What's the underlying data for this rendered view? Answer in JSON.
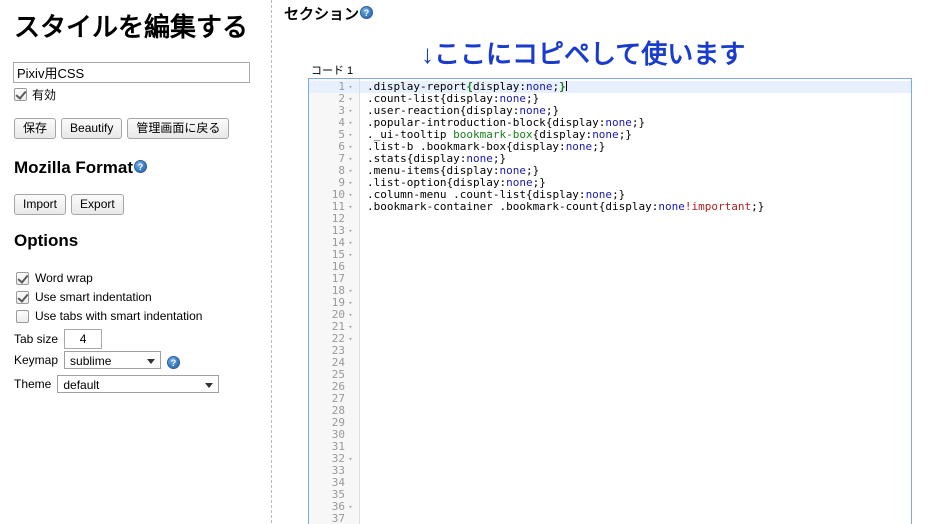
{
  "left": {
    "title": "スタイルを編集する",
    "style_name_input": {
      "value": "Pixiv用CSS",
      "placeholder": ""
    },
    "enabled_checkbox": {
      "label": "有効",
      "checked": true
    },
    "main_buttons": [
      "保存",
      "Beautify",
      "管理画面に戻る"
    ],
    "mozilla_format": {
      "heading": "Mozilla Format",
      "help_icon": "help-icon",
      "buttons": [
        "Import",
        "Export"
      ]
    },
    "options": {
      "heading": "Options",
      "checkboxes": [
        {
          "label": "Word wrap",
          "checked": true
        },
        {
          "label": "Use smart indentation",
          "checked": true
        },
        {
          "label": "Use tabs with smart indentation",
          "checked": false
        }
      ],
      "tab_size": {
        "label": "Tab size",
        "value": "4"
      },
      "keymap": {
        "label": "Keymap",
        "value": "sublime",
        "help_icon": "help-icon"
      },
      "theme": {
        "label": "Theme",
        "value": "default"
      }
    }
  },
  "right": {
    "section_heading": "セクション",
    "section_help_icon": "help-icon",
    "annotation": "↓ここにコピペして使います",
    "annotation_color": "#1a3ccc",
    "code_label": "コード 1",
    "editor": {
      "border_color": "#7fa9e3",
      "active_line_color": "#e8f0fd",
      "total_visible_lines": 37,
      "active_line": 1,
      "fold_marker": "▾",
      "fold_lines": [
        1,
        2,
        3,
        4,
        5,
        6,
        7,
        8,
        9,
        10,
        11,
        13,
        14,
        15,
        18,
        19,
        20,
        21,
        22,
        32,
        36
      ],
      "lines": [
        {
          "n": 1,
          "tokens": [
            {
              "t": ".display-report",
              "c": "sel"
            },
            {
              "t": "{",
              "c": "brace"
            },
            {
              "t": "display",
              "c": "prop"
            },
            {
              "t": ":",
              "c": "prop"
            },
            {
              "t": "none",
              "c": "val"
            },
            {
              "t": ";",
              "c": "prop"
            },
            {
              "t": "}",
              "c": "brace"
            }
          ],
          "caret": true
        },
        {
          "n": 2,
          "tokens": [
            {
              "t": ".count-list",
              "c": "sel"
            },
            {
              "t": "{display:",
              "c": "prop"
            },
            {
              "t": "none",
              "c": "val"
            },
            {
              "t": ";}",
              "c": "prop"
            }
          ]
        },
        {
          "n": 3,
          "tokens": [
            {
              "t": ".user-reaction",
              "c": "sel"
            },
            {
              "t": "{display:",
              "c": "prop"
            },
            {
              "t": "none",
              "c": "val"
            },
            {
              "t": ";}",
              "c": "prop"
            }
          ]
        },
        {
          "n": 4,
          "tokens": [
            {
              "t": ".popular-introduction-block",
              "c": "sel"
            },
            {
              "t": "{display:",
              "c": "prop"
            },
            {
              "t": "none",
              "c": "val"
            },
            {
              "t": ";}",
              "c": "prop"
            }
          ]
        },
        {
          "n": 5,
          "tokens": [
            {
              "t": "._ui-tooltip ",
              "c": "sel"
            },
            {
              "t": "bookmark-box",
              "c": "tag"
            },
            {
              "t": "{display:",
              "c": "prop"
            },
            {
              "t": "none",
              "c": "val"
            },
            {
              "t": ";}",
              "c": "prop"
            }
          ]
        },
        {
          "n": 6,
          "tokens": [
            {
              "t": ".list-b .bookmark-box",
              "c": "sel"
            },
            {
              "t": "{display:",
              "c": "prop"
            },
            {
              "t": "none",
              "c": "val"
            },
            {
              "t": ";}",
              "c": "prop"
            }
          ]
        },
        {
          "n": 7,
          "tokens": [
            {
              "t": ".stats",
              "c": "sel"
            },
            {
              "t": "{display:",
              "c": "prop"
            },
            {
              "t": "none",
              "c": "val"
            },
            {
              "t": ";}",
              "c": "prop"
            }
          ]
        },
        {
          "n": 8,
          "tokens": [
            {
              "t": ".menu-items",
              "c": "sel"
            },
            {
              "t": "{display:",
              "c": "prop"
            },
            {
              "t": "none",
              "c": "val"
            },
            {
              "t": ";}",
              "c": "prop"
            }
          ]
        },
        {
          "n": 9,
          "tokens": [
            {
              "t": ".list-option",
              "c": "sel"
            },
            {
              "t": "{display:",
              "c": "prop"
            },
            {
              "t": "none",
              "c": "val"
            },
            {
              "t": ";}",
              "c": "prop"
            }
          ]
        },
        {
          "n": 10,
          "tokens": [
            {
              "t": ".column-menu .count-list",
              "c": "sel"
            },
            {
              "t": "{display:",
              "c": "prop"
            },
            {
              "t": "none",
              "c": "val"
            },
            {
              "t": ";}",
              "c": "prop"
            }
          ]
        },
        {
          "n": 11,
          "tokens": [
            {
              "t": ".bookmark-container .bookmark-count",
              "c": "sel"
            },
            {
              "t": "{display:",
              "c": "prop"
            },
            {
              "t": "none",
              "c": "val"
            },
            {
              "t": "!important",
              "c": "imp"
            },
            {
              "t": ";}",
              "c": "prop"
            }
          ]
        },
        {
          "n": 12,
          "tokens": []
        },
        {
          "n": 13,
          "tokens": []
        },
        {
          "n": 14,
          "tokens": []
        },
        {
          "n": 15,
          "tokens": []
        },
        {
          "n": 16,
          "tokens": []
        },
        {
          "n": 17,
          "tokens": []
        },
        {
          "n": 18,
          "tokens": []
        },
        {
          "n": 19,
          "tokens": []
        },
        {
          "n": 20,
          "tokens": []
        },
        {
          "n": 21,
          "tokens": []
        },
        {
          "n": 22,
          "tokens": []
        },
        {
          "n": 23,
          "tokens": []
        },
        {
          "n": 24,
          "tokens": []
        },
        {
          "n": 25,
          "tokens": []
        },
        {
          "n": 26,
          "tokens": []
        },
        {
          "n": 27,
          "tokens": []
        },
        {
          "n": 28,
          "tokens": []
        },
        {
          "n": 29,
          "tokens": []
        },
        {
          "n": 30,
          "tokens": []
        },
        {
          "n": 31,
          "tokens": []
        },
        {
          "n": 32,
          "tokens": []
        },
        {
          "n": 33,
          "tokens": []
        },
        {
          "n": 34,
          "tokens": []
        },
        {
          "n": 35,
          "tokens": []
        },
        {
          "n": 36,
          "tokens": []
        },
        {
          "n": 37,
          "tokens": []
        }
      ]
    }
  }
}
